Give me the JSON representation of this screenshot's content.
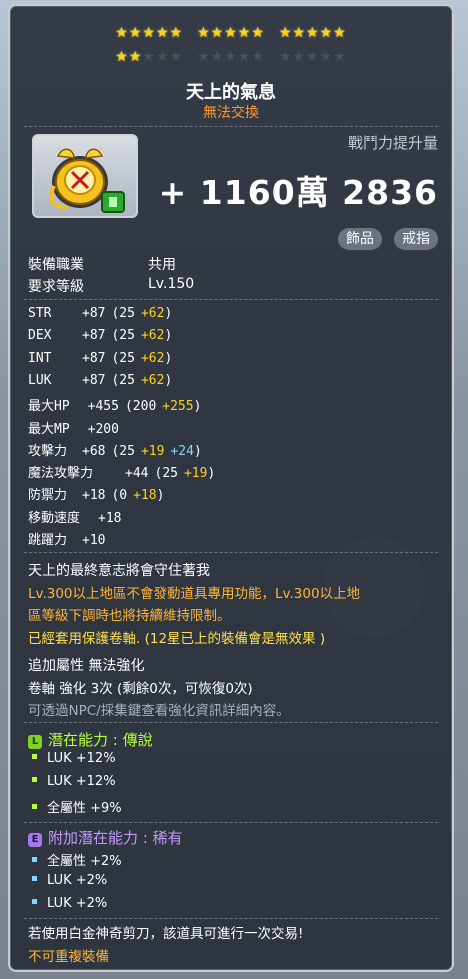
{
  "stars": {
    "row1": [
      1,
      1,
      1,
      1,
      1,
      1,
      1,
      1,
      1,
      1,
      1,
      1,
      1,
      1,
      1
    ],
    "row2": [
      1,
      1,
      0,
      0,
      0,
      0,
      0,
      0,
      0,
      0,
      0,
      0,
      0,
      0,
      0
    ]
  },
  "item": {
    "name": "天上的氣息",
    "trade": "無法交換",
    "icon": "pendant-icon"
  },
  "power": {
    "label": "戰鬥力提升量",
    "value": "+ 1160萬 2836"
  },
  "tags": [
    "飾品",
    "戒指"
  ],
  "info": [
    {
      "label": "裝備職業",
      "value": "共用"
    },
    {
      "label": "要求等級",
      "value": "Lv.150"
    }
  ],
  "stats": [
    {
      "name": "STR",
      "total": "+87",
      "base": "(25",
      "bonus1": "+62",
      "bonus2": "",
      "close": ")"
    },
    {
      "name": "DEX",
      "total": "+87",
      "base": "(25",
      "bonus1": "+62",
      "bonus2": "",
      "close": ")"
    },
    {
      "name": "INT",
      "total": "+87",
      "base": "(25",
      "bonus1": "+62",
      "bonus2": "",
      "close": ")"
    },
    {
      "name": "LUK",
      "total": "+87",
      "base": "(25",
      "bonus1": "+62",
      "bonus2": "",
      "close": ")"
    },
    {
      "name": "最大HP",
      "total": "+455",
      "base": "(200",
      "bonus1": "+255",
      "bonus2": "",
      "close": ")"
    },
    {
      "name": "最大MP",
      "total": "+200",
      "base": "",
      "bonus1": "",
      "bonus2": "",
      "close": ""
    },
    {
      "name": "攻擊力",
      "total": "+68",
      "base": "(25",
      "bonus1": "+19",
      "bonus2": "+24",
      "close": ")"
    },
    {
      "name": "魔法攻擊力",
      "total": "+44",
      "base": "(25",
      "bonus1": "+19",
      "bonus2": "",
      "close": ")"
    },
    {
      "name": "防禦力",
      "total": "+18",
      "base": "(0",
      "bonus1": "+18",
      "bonus2": "",
      "close": ")"
    },
    {
      "name": "移動速度",
      "total": "+18",
      "base": "",
      "bonus1": "",
      "bonus2": "",
      "close": ""
    },
    {
      "name": "跳躍力",
      "total": "+10",
      "base": "",
      "bonus1": "",
      "bonus2": "",
      "close": ""
    }
  ],
  "desc": {
    "line1": "天上的最終意志將會守住著我",
    "line2": "Lv.300以上地區不會發動道具專用功能，Lv.300以上地",
    "line3": "區等級下調時也將持續維持限制。",
    "line4": "已經套用保護卷軸. (12星已上的裝備會是無效果 )",
    "line5": "追加屬性 無法強化",
    "line6": "卷軸 強化 3次 (剩餘0次，可恢復0次)",
    "line7": "可透過NPC/採集鍵查看強化資訊詳細內容。"
  },
  "potential": {
    "badge": "L",
    "title": "潛在能力 : 傳說",
    "color": "#b6ff3a",
    "lines": [
      "LUK +12%",
      "LUK +12%",
      "全屬性 +9%"
    ]
  },
  "additional": {
    "badge": "E",
    "title": "附加潛在能力 : 稀有",
    "color": "#c497ff",
    "lines": [
      "全屬性 +2%",
      "LUK +2%",
      "LUK +2%"
    ]
  },
  "footer": {
    "line1": "若使用白金神奇剪刀，該道具可進行一次交易!",
    "line2": "不可重複裝備"
  }
}
